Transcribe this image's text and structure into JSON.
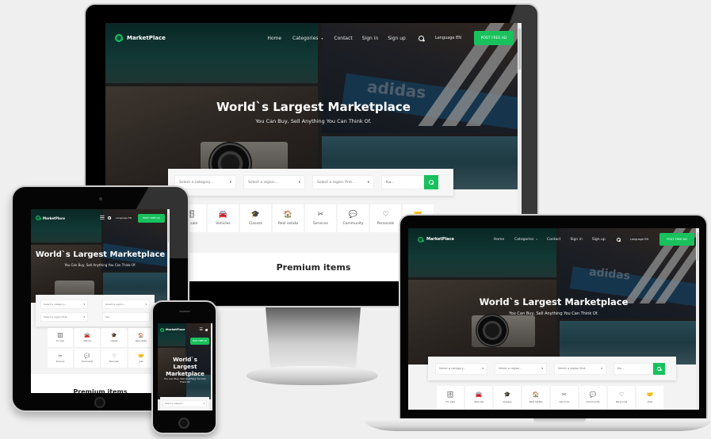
{
  "site": {
    "brand": "MarketPlace",
    "nav": [
      "Home",
      "Categories",
      "Contact",
      "Sign in",
      "Sign up"
    ],
    "language": "Language EN",
    "cta": "POST FREE AD",
    "hero_title": "World`s Largest Marketplace",
    "hero_subtitle": "You Can Buy, Sell Anything You Can Think Of.",
    "hero_photo_brand_text": "adidas",
    "search": {
      "category_placeholder": "Select a category...",
      "region_placeholder": "Select a region...",
      "subregion_placeholder": "Select a region first...",
      "keyword_placeholder": "Kw...",
      "caret": "▾"
    },
    "categories": [
      {
        "label": "For sale",
        "icon": "🗄"
      },
      {
        "label": "Vehicles",
        "icon": "🚘"
      },
      {
        "label": "Classes",
        "icon": "🎓"
      },
      {
        "label": "Real estate",
        "icon": "🏠"
      },
      {
        "label": "Services",
        "icon": "✂"
      },
      {
        "label": "Community",
        "icon": "💬"
      },
      {
        "label": "Personals",
        "icon": "♡"
      },
      {
        "label": "Jobs",
        "icon": "🤝"
      }
    ],
    "section_title": "Premium items"
  },
  "colors": {
    "accent": "#19c15d",
    "page_background": "#efefef",
    "device_bezel": "#000000"
  }
}
